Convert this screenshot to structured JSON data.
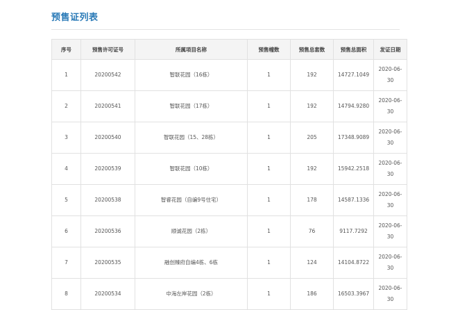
{
  "page": {
    "title": "预售证列表"
  },
  "table": {
    "headers": [
      "序号",
      "预售许可证号",
      "所属项目名称",
      "预售幢数",
      "预售总套数",
      "预售总面积",
      "发证日期"
    ],
    "rows": [
      {
        "index": "1",
        "permit": "20200542",
        "project": "智联花园（16栋）",
        "buildings": "1",
        "units": "192",
        "area": "14727.1049",
        "date_a": "2020-06-",
        "date_b": "30"
      },
      {
        "index": "2",
        "permit": "20200541",
        "project": "智联花园（17栋）",
        "buildings": "1",
        "units": "192",
        "area": "14794.9280",
        "date_a": "2020-06-",
        "date_b": "30"
      },
      {
        "index": "3",
        "permit": "20200540",
        "project": "智联花园（15、28栋）",
        "buildings": "1",
        "units": "205",
        "area": "17348.9089",
        "date_a": "2020-06-",
        "date_b": "30"
      },
      {
        "index": "4",
        "permit": "20200539",
        "project": "智联花园（10栋）",
        "buildings": "1",
        "units": "192",
        "area": "15942.2518",
        "date_a": "2020-06-",
        "date_b": "30"
      },
      {
        "index": "5",
        "permit": "20200538",
        "project": "智睿花园（自编9号住宅）",
        "buildings": "1",
        "units": "178",
        "area": "14587.1336",
        "date_a": "2020-06-",
        "date_b": "30"
      },
      {
        "index": "6",
        "permit": "20200536",
        "project": "顺诚花园（2栋）",
        "buildings": "1",
        "units": "76",
        "area": "9117.7292",
        "date_a": "2020-06-",
        "date_b": "30"
      },
      {
        "index": "7",
        "permit": "20200535",
        "project": "融创臻府自编4栋、6栋",
        "buildings": "1",
        "units": "124",
        "area": "14104.8722",
        "date_a": "2020-06-",
        "date_b": "30"
      },
      {
        "index": "8",
        "permit": "20200534",
        "project": "中海左岸花园（2栋）",
        "buildings": "1",
        "units": "186",
        "area": "16503.3967",
        "date_a": "2020-06-",
        "date_b": "30"
      }
    ]
  }
}
